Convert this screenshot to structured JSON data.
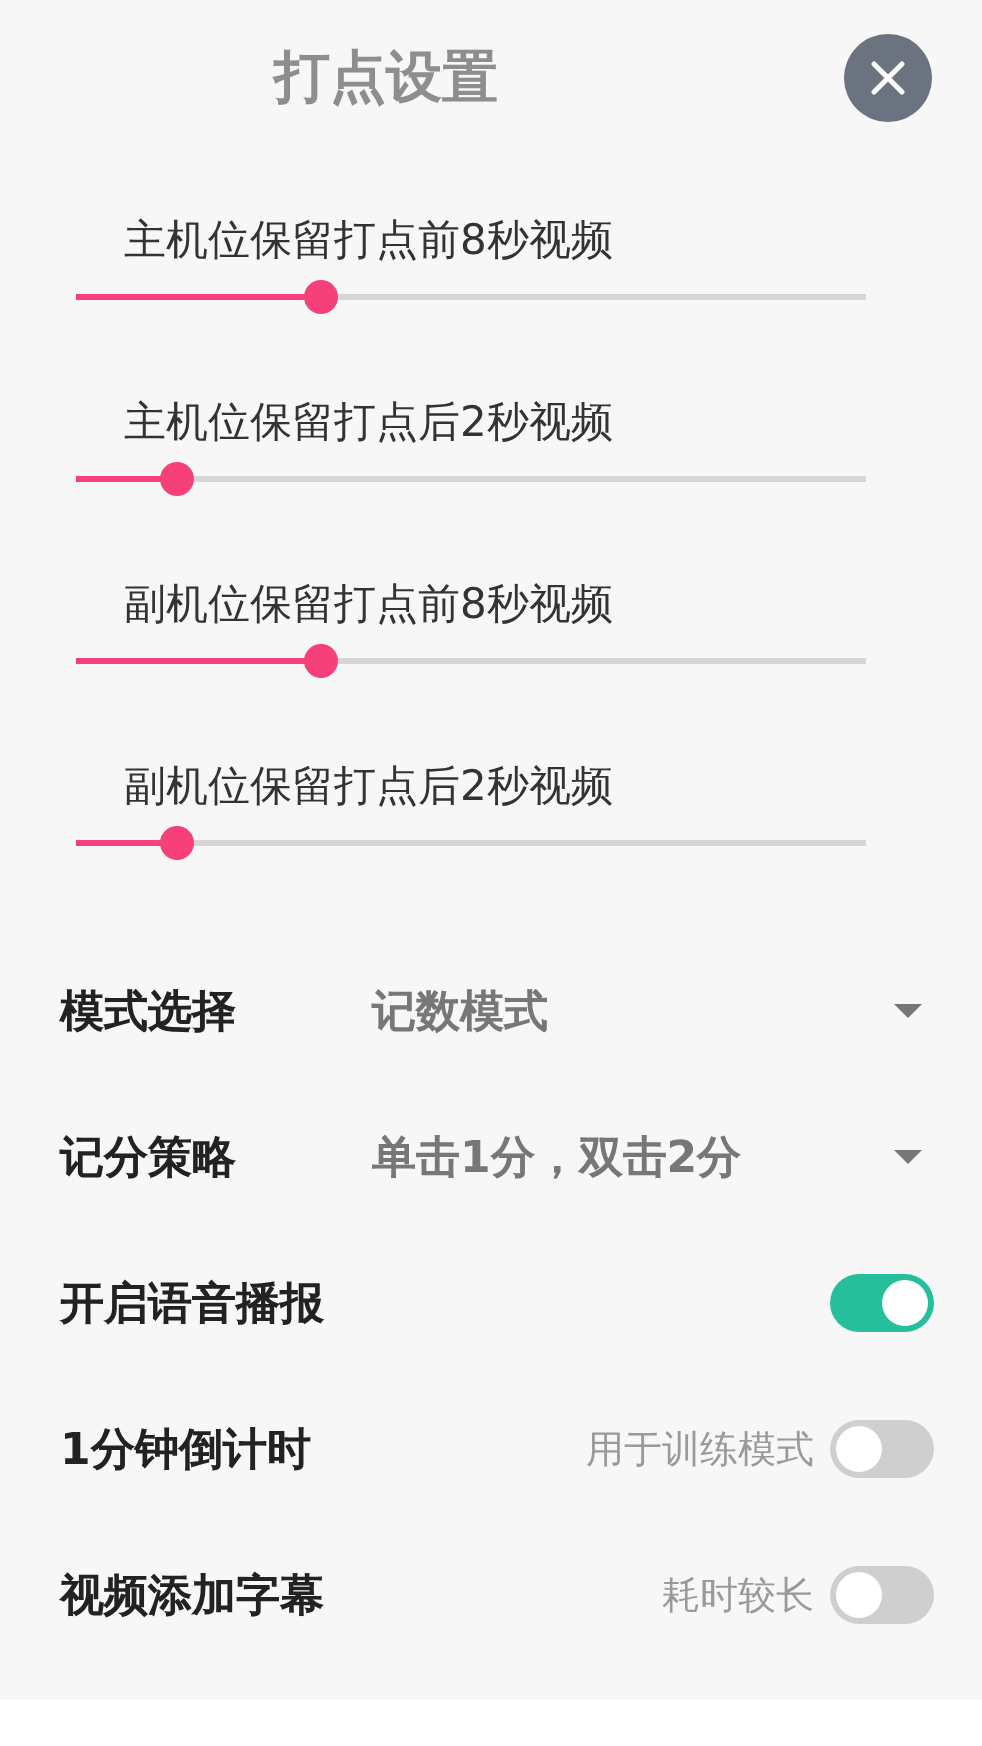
{
  "dialog": {
    "title": "打点设置"
  },
  "sliders": [
    {
      "label": "主机位保留打点前8秒视频",
      "level": 0.31
    },
    {
      "label": "主机位保留打点后2秒视频",
      "level": 0.127
    },
    {
      "label": "副机位保留打点前8秒视频",
      "level": 0.31
    },
    {
      "label": "副机位保留打点后2秒视频",
      "level": 0.127
    }
  ],
  "settings": [
    {
      "kind": "dropdown",
      "label": "模式选择",
      "value": "记数模式"
    },
    {
      "kind": "dropdown",
      "label": "记分策略",
      "value": "单击1分，双击2分"
    },
    {
      "kind": "toggle",
      "label": "开启语音播报",
      "on": true
    },
    {
      "kind": "toggle",
      "label": "1分钟倒计时",
      "hint": "用于训练模式",
      "on": false
    },
    {
      "kind": "toggle",
      "label": "视频添加字幕",
      "hint": "耗时较长",
      "on": false
    }
  ]
}
